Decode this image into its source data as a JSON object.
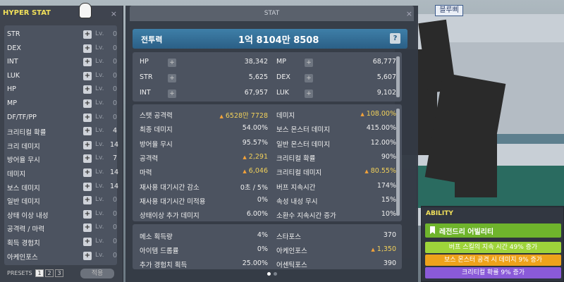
{
  "name_tag": "블루삐",
  "hyper_stat": {
    "title": "HYPER STAT",
    "close": "×",
    "rows": [
      {
        "label": "STR",
        "lv_label": "Lv.",
        "lv": "0"
      },
      {
        "label": "DEX",
        "lv_label": "Lv.",
        "lv": "0"
      },
      {
        "label": "INT",
        "lv_label": "Lv.",
        "lv": "0"
      },
      {
        "label": "LUK",
        "lv_label": "Lv.",
        "lv": "0"
      },
      {
        "label": "HP",
        "lv_label": "Lv.",
        "lv": "0"
      },
      {
        "label": "MP",
        "lv_label": "Lv.",
        "lv": "0"
      },
      {
        "label": "DF/TF/PP",
        "lv_label": "Lv.",
        "lv": "0"
      },
      {
        "label": "크리티컬 확률",
        "lv_label": "Lv.",
        "lv": "4"
      },
      {
        "label": "크리 데미지",
        "lv_label": "Lv.",
        "lv": "14"
      },
      {
        "label": "방어율 무시",
        "lv_label": "Lv.",
        "lv": "7"
      },
      {
        "label": "데미지",
        "lv_label": "Lv.",
        "lv": "14"
      },
      {
        "label": "보스 데미지",
        "lv_label": "Lv.",
        "lv": "14"
      },
      {
        "label": "일반 데미지",
        "lv_label": "Lv.",
        "lv": "0"
      },
      {
        "label": "상태 이상 내성",
        "lv_label": "Lv.",
        "lv": "0"
      },
      {
        "label": "공격력 / 마력",
        "lv_label": "Lv.",
        "lv": "0"
      },
      {
        "label": "획득 경험치",
        "lv_label": "Lv.",
        "lv": "0"
      },
      {
        "label": "아케인포스",
        "lv_label": "Lv.",
        "lv": "0"
      }
    ],
    "presets_label": "PRESETS",
    "presets": [
      "1",
      "2",
      "3"
    ],
    "apply_label": "적용"
  },
  "stat": {
    "title": "STAT",
    "close": "×",
    "combat_power_label": "전투력",
    "combat_power_value": "1억 8104만 8508",
    "help": "?",
    "basic": [
      {
        "label": "HP",
        "value": "38,342"
      },
      {
        "label": "MP",
        "value": "68,777"
      },
      {
        "label": "STR",
        "value": "5,625"
      },
      {
        "label": "DEX",
        "value": "5,607"
      },
      {
        "label": "INT",
        "value": "67,957"
      },
      {
        "label": "LUK",
        "value": "9,102"
      }
    ],
    "detail_left": [
      {
        "label": "스탯 공격력",
        "value": "6528만 7728",
        "up": true
      },
      {
        "label": "최종 데미지",
        "value": "54.00%"
      },
      {
        "label": "방어율 무시",
        "value": "95.57%"
      },
      {
        "label": "공격력",
        "value": "2,291",
        "up": true
      },
      {
        "label": "마력",
        "value": "6,046",
        "up": true
      },
      {
        "label": "재사용 대기시간 감소",
        "value": "0초 / 5%"
      },
      {
        "label": "재사용 대기시간 미적용",
        "value": "0%"
      },
      {
        "label": "상태이상 추가 데미지",
        "value": "6.00%"
      }
    ],
    "detail_right": [
      {
        "label": "데미지",
        "value": "108.00%",
        "up": true
      },
      {
        "label": "보스 몬스터 데미지",
        "value": "415.00%"
      },
      {
        "label": "일반 몬스터 데미지",
        "value": "12.00%"
      },
      {
        "label": "크리티컬 확률",
        "value": "90%"
      },
      {
        "label": "크리티컬 데미지",
        "value": "80.55%",
        "up": true
      },
      {
        "label": "버프 지속시간",
        "value": "174%"
      },
      {
        "label": "속성 내성 무시",
        "value": "15%"
      },
      {
        "label": "소환수 지속시간 증가",
        "value": "10%"
      }
    ],
    "extra_left": [
      {
        "label": "메소 획득량",
        "value": "4%"
      },
      {
        "label": "아이템 드롭률",
        "value": "0%"
      },
      {
        "label": "추가 경험치 획득",
        "value": "25.00%"
      }
    ],
    "extra_right": [
      {
        "label": "스타포스",
        "value": "370"
      },
      {
        "label": "아케인포스",
        "value": "1,350",
        "up": true
      },
      {
        "label": "어센틱포스",
        "value": "390"
      }
    ]
  },
  "ability": {
    "title": "ABILITY",
    "grade": "레전드리 어빌리티",
    "lines": [
      "버프 스킬의 지속 시간 49% 증가",
      "보스 몬스터 공격 시 데미지 9% 증가",
      "크리티컬 확률 9% 증가"
    ]
  },
  "colors": {
    "hyper_title": "#f2e15a",
    "power_bar": "#2b5f86",
    "up_value": "#f2d15a",
    "legendary": "#6fb42c",
    "line_green": "#9ed43a",
    "line_orange": "#eea21b",
    "line_purple": "#8a5ad8"
  }
}
